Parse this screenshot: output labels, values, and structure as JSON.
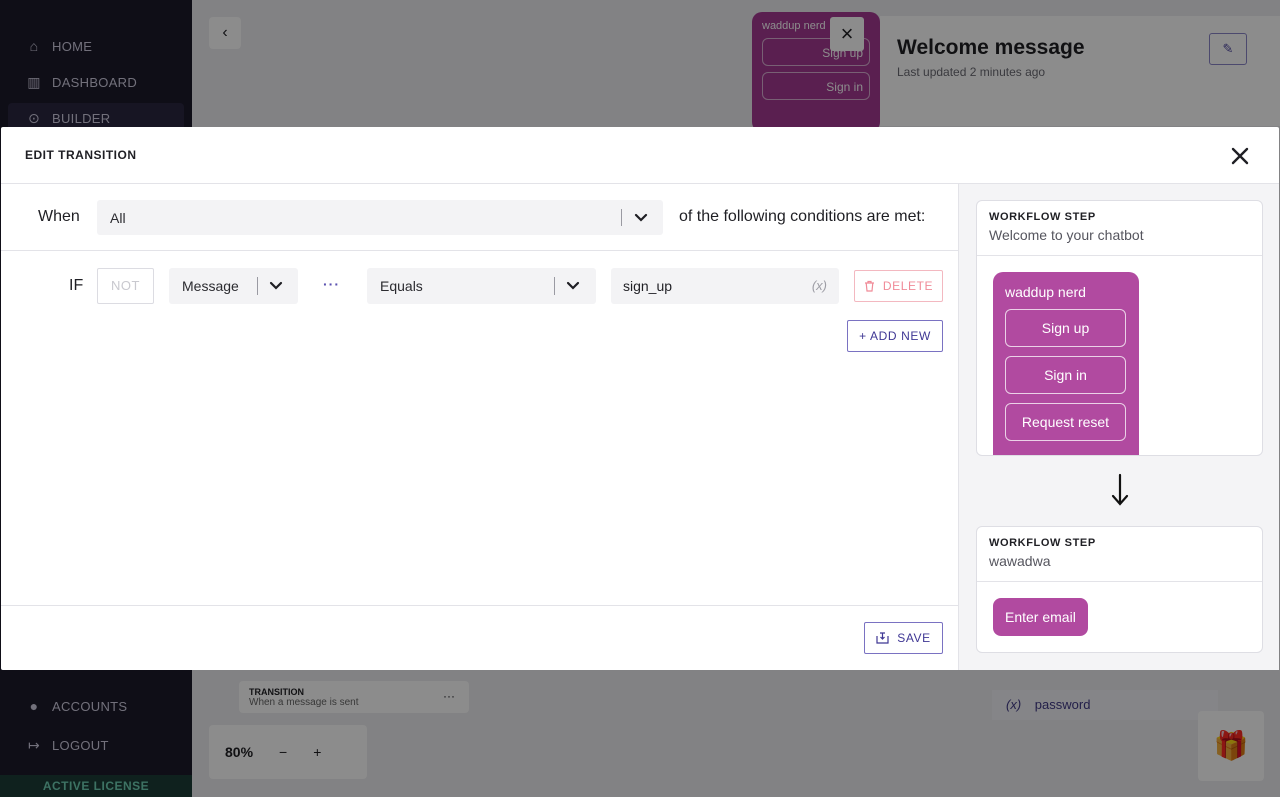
{
  "sidebar": {
    "items": [
      {
        "label": "HOME",
        "icon": "home-icon"
      },
      {
        "label": "DASHBOARD",
        "icon": "chart-icon"
      },
      {
        "label": "BUILDER",
        "icon": "builder-icon"
      },
      {
        "label": "ACCOUNTS",
        "icon": "user-icon"
      },
      {
        "label": "LOGOUT",
        "icon": "logout-icon"
      }
    ],
    "license": "ACTIVE LICENSE"
  },
  "background": {
    "mini_bubble": {
      "text": "waddup nerd",
      "buttons": [
        "Sign up",
        "Sign in"
      ]
    },
    "panel": {
      "title": "Welcome message",
      "updated": "Last updated 2 minutes ago"
    },
    "transition_card": {
      "title": "TRANSITION",
      "subtitle": "When a message is sent"
    },
    "zoom": {
      "value": "80%",
      "minus": "−",
      "plus": "+"
    },
    "variable": {
      "icon_text": "(x)",
      "name": "password"
    }
  },
  "modal": {
    "title": "EDIT TRANSITION",
    "when_label": "When",
    "when_value": "All",
    "when_suffix": "of the following conditions are met:",
    "condition": {
      "if_label": "IF",
      "not_label": "NOT",
      "field": "Message",
      "dots": "···",
      "operator": "Equals",
      "value": "sign_up",
      "var_icon": "(x)",
      "delete_label": "DELETE"
    },
    "add_new_label": "+ ADD NEW",
    "save_label": "SAVE"
  },
  "preview": {
    "step1": {
      "kind": "WORKFLOW STEP",
      "name": "Welcome to your chatbot",
      "message": "waddup nerd",
      "buttons": [
        "Sign up",
        "Sign in",
        "Request reset"
      ]
    },
    "step2": {
      "kind": "WORKFLOW STEP",
      "name": "wawadwa",
      "pill": "Enter email"
    }
  },
  "colors": {
    "accent": "#3f3794",
    "bubble": "#b14aa0",
    "danger": "#f08b98",
    "sidebar_bg": "#1c1a2b"
  }
}
